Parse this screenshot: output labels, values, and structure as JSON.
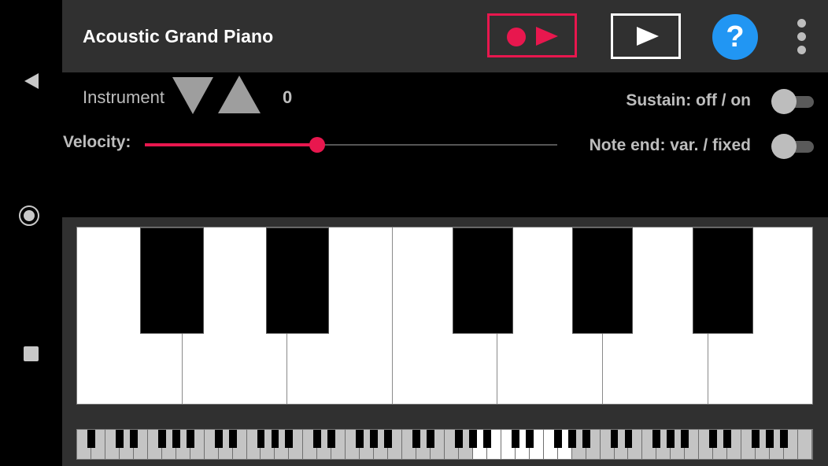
{
  "app": {
    "title": "Acoustic Grand Piano"
  },
  "toolbar": {
    "record_play_icon": "record-play-icon",
    "play_icon": "play-icon",
    "help_label": "?",
    "more_icon": "more-vertical-icon"
  },
  "controls": {
    "instrument_label": "Instrument",
    "instrument_value": "0",
    "velocity_label": "Velocity:",
    "velocity_fraction": 0.418,
    "sustain_label": "Sustain: off / on",
    "sustain_on": false,
    "note_end_label": "Note end: var. / fixed",
    "note_end_fixed": false
  },
  "keyboard": {
    "visible_white_keys": 7,
    "mini_white_keys": 52,
    "mini_selected_start": 28,
    "mini_selected_count": 7
  },
  "colors": {
    "accent": "#e8174e",
    "help": "#2196f3",
    "appbar": "#303030"
  },
  "navbar": {
    "back_icon": "back-icon",
    "home_icon": "home-icon",
    "recents_icon": "recents-icon"
  }
}
